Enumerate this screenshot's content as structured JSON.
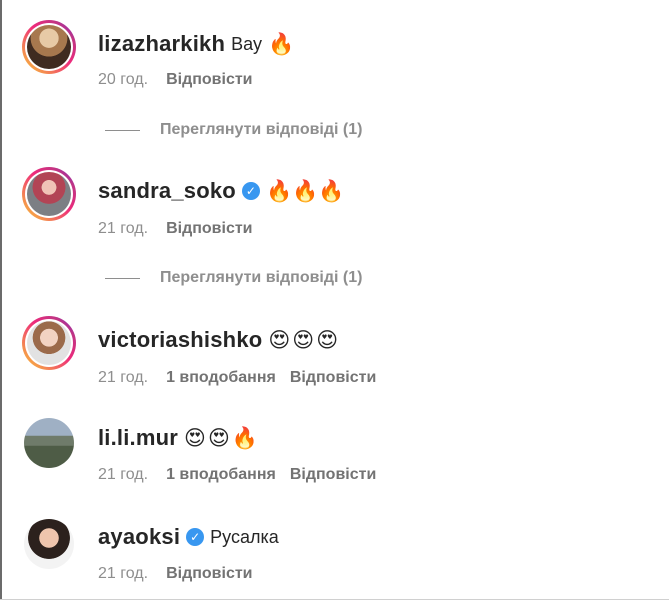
{
  "comments": [
    {
      "username": "lizazharkikh",
      "verified": false,
      "text": "Вау",
      "emojis": [
        "🔥"
      ],
      "time": "20 год.",
      "likes": "",
      "reply_label": "Відповісти",
      "view_replies": "Переглянути відповіді (1)"
    },
    {
      "username": "sandra_soko",
      "verified": true,
      "text": "",
      "emojis": [
        "🔥",
        "🔥",
        "🔥"
      ],
      "time": "21 год.",
      "likes": "",
      "reply_label": "Відповісти",
      "view_replies": "Переглянути відповіді (1)"
    },
    {
      "username": "victoriashishko",
      "verified": false,
      "text": "",
      "emojis": [
        "😍",
        "😍",
        "😍"
      ],
      "time": "21 год.",
      "likes": "1 вподобання",
      "reply_label": "Відповісти",
      "view_replies": ""
    },
    {
      "username": "li.li.mur",
      "verified": false,
      "text": "",
      "emojis": [
        "😍",
        "😍",
        "🔥"
      ],
      "time": "21 год.",
      "likes": "1 вподобання",
      "reply_label": "Відповісти",
      "view_replies": ""
    },
    {
      "username": "ayaoksi",
      "verified": true,
      "text": "Русалка",
      "emojis": [],
      "time": "21 год.",
      "likes": "",
      "reply_label": "Відповісти",
      "view_replies": ""
    }
  ],
  "colors": {
    "verified": "#3897f0",
    "story_ring_start": "#f9ce34",
    "story_ring_end": "#6228d7",
    "meta_text": "#8e8e8e"
  }
}
